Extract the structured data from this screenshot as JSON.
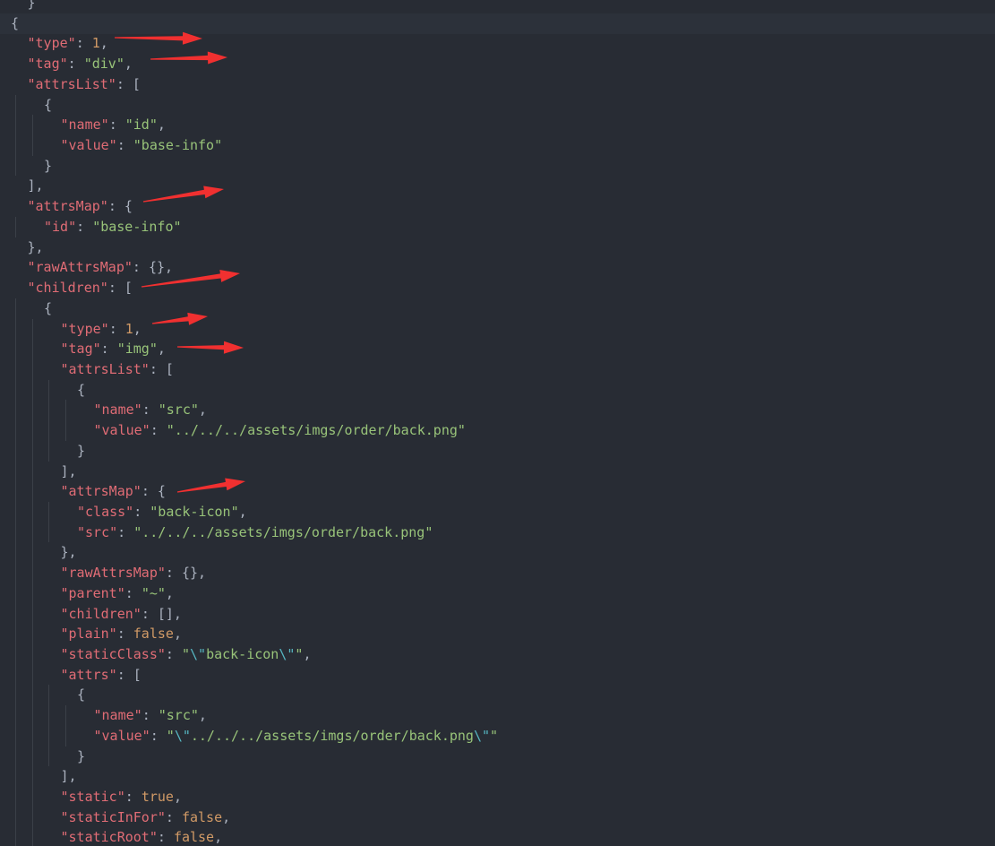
{
  "editor": {
    "colors": {
      "background": "#282c34",
      "key": "#e06c75",
      "string": "#98c379",
      "number": "#d19a66",
      "escape": "#56b6c2",
      "punctuation": "#abb2bf",
      "annotation_arrow": "#f03030"
    },
    "active_line": 1,
    "lines": [
      {
        "indent": 1,
        "tokens": [
          [
            "p",
            "}"
          ]
        ]
      },
      {
        "indent": 0,
        "tokens": [
          [
            "p",
            "{"
          ]
        ]
      },
      {
        "indent": 1,
        "tokens": [
          [
            "k",
            "\"type\""
          ],
          [
            "p",
            ": "
          ],
          [
            "n",
            "1"
          ],
          [
            "p",
            ","
          ]
        ]
      },
      {
        "indent": 1,
        "tokens": [
          [
            "k",
            "\"tag\""
          ],
          [
            "p",
            ": "
          ],
          [
            "s",
            "\"div\""
          ],
          [
            "p",
            ","
          ]
        ]
      },
      {
        "indent": 1,
        "tokens": [
          [
            "k",
            "\"attrsList\""
          ],
          [
            "p",
            ": ["
          ]
        ]
      },
      {
        "indent": 2,
        "tokens": [
          [
            "p",
            "{"
          ]
        ]
      },
      {
        "indent": 3,
        "tokens": [
          [
            "k",
            "\"name\""
          ],
          [
            "p",
            ": "
          ],
          [
            "s",
            "\"id\""
          ],
          [
            "p",
            ","
          ]
        ]
      },
      {
        "indent": 3,
        "tokens": [
          [
            "k",
            "\"value\""
          ],
          [
            "p",
            ": "
          ],
          [
            "s",
            "\"base-info\""
          ]
        ]
      },
      {
        "indent": 2,
        "tokens": [
          [
            "p",
            "}"
          ]
        ]
      },
      {
        "indent": 1,
        "tokens": [
          [
            "p",
            "],"
          ]
        ]
      },
      {
        "indent": 1,
        "tokens": [
          [
            "k",
            "\"attrsMap\""
          ],
          [
            "p",
            ": {"
          ]
        ]
      },
      {
        "indent": 2,
        "tokens": [
          [
            "k",
            "\"id\""
          ],
          [
            "p",
            ": "
          ],
          [
            "s",
            "\"base-info\""
          ]
        ]
      },
      {
        "indent": 1,
        "tokens": [
          [
            "p",
            "},"
          ]
        ]
      },
      {
        "indent": 1,
        "tokens": [
          [
            "k",
            "\"rawAttrsMap\""
          ],
          [
            "p",
            ": {},"
          ]
        ]
      },
      {
        "indent": 1,
        "tokens": [
          [
            "k",
            "\"children\""
          ],
          [
            "p",
            ": ["
          ]
        ]
      },
      {
        "indent": 2,
        "tokens": [
          [
            "p",
            "{"
          ]
        ]
      },
      {
        "indent": 3,
        "tokens": [
          [
            "k",
            "\"type\""
          ],
          [
            "p",
            ": "
          ],
          [
            "n",
            "1"
          ],
          [
            "p",
            ","
          ]
        ]
      },
      {
        "indent": 3,
        "tokens": [
          [
            "k",
            "\"tag\""
          ],
          [
            "p",
            ": "
          ],
          [
            "s",
            "\"img\""
          ],
          [
            "p",
            ","
          ]
        ]
      },
      {
        "indent": 3,
        "tokens": [
          [
            "k",
            "\"attrsList\""
          ],
          [
            "p",
            ": ["
          ]
        ]
      },
      {
        "indent": 4,
        "tokens": [
          [
            "p",
            "{"
          ]
        ]
      },
      {
        "indent": 5,
        "tokens": [
          [
            "k",
            "\"name\""
          ],
          [
            "p",
            ": "
          ],
          [
            "s",
            "\"src\""
          ],
          [
            "p",
            ","
          ]
        ]
      },
      {
        "indent": 5,
        "tokens": [
          [
            "k",
            "\"value\""
          ],
          [
            "p",
            ": "
          ],
          [
            "s",
            "\"../../../assets/imgs/order/back.png\""
          ]
        ]
      },
      {
        "indent": 4,
        "tokens": [
          [
            "p",
            "}"
          ]
        ]
      },
      {
        "indent": 3,
        "tokens": [
          [
            "p",
            "],"
          ]
        ]
      },
      {
        "indent": 3,
        "tokens": [
          [
            "k",
            "\"attrsMap\""
          ],
          [
            "p",
            ": {"
          ]
        ]
      },
      {
        "indent": 4,
        "tokens": [
          [
            "k",
            "\"class\""
          ],
          [
            "p",
            ": "
          ],
          [
            "s",
            "\"back-icon\""
          ],
          [
            "p",
            ","
          ]
        ]
      },
      {
        "indent": 4,
        "tokens": [
          [
            "k",
            "\"src\""
          ],
          [
            "p",
            ": "
          ],
          [
            "s",
            "\"../../../assets/imgs/order/back.png\""
          ]
        ]
      },
      {
        "indent": 3,
        "tokens": [
          [
            "p",
            "},"
          ]
        ]
      },
      {
        "indent": 3,
        "tokens": [
          [
            "k",
            "\"rawAttrsMap\""
          ],
          [
            "p",
            ": {},"
          ]
        ]
      },
      {
        "indent": 3,
        "tokens": [
          [
            "k",
            "\"parent\""
          ],
          [
            "p",
            ": "
          ],
          [
            "s",
            "\"~\""
          ],
          [
            "p",
            ","
          ]
        ]
      },
      {
        "indent": 3,
        "tokens": [
          [
            "k",
            "\"children\""
          ],
          [
            "p",
            ": [],"
          ]
        ]
      },
      {
        "indent": 3,
        "tokens": [
          [
            "k",
            "\"plain\""
          ],
          [
            "p",
            ": "
          ],
          [
            "n",
            "false"
          ],
          [
            "p",
            ","
          ]
        ]
      },
      {
        "indent": 3,
        "tokens": [
          [
            "k",
            "\"staticClass\""
          ],
          [
            "p",
            ": "
          ],
          [
            "s",
            "\""
          ],
          [
            "e",
            "\\\""
          ],
          [
            "s",
            "back-icon"
          ],
          [
            "e",
            "\\\""
          ],
          [
            "s",
            "\""
          ],
          [
            "p",
            ","
          ]
        ]
      },
      {
        "indent": 3,
        "tokens": [
          [
            "k",
            "\"attrs\""
          ],
          [
            "p",
            ": ["
          ]
        ]
      },
      {
        "indent": 4,
        "tokens": [
          [
            "p",
            "{"
          ]
        ]
      },
      {
        "indent": 5,
        "tokens": [
          [
            "k",
            "\"name\""
          ],
          [
            "p",
            ": "
          ],
          [
            "s",
            "\"src\""
          ],
          [
            "p",
            ","
          ]
        ]
      },
      {
        "indent": 5,
        "tokens": [
          [
            "k",
            "\"value\""
          ],
          [
            "p",
            ": "
          ],
          [
            "s",
            "\""
          ],
          [
            "e",
            "\\\""
          ],
          [
            "s",
            "../../../assets/imgs/order/back.png"
          ],
          [
            "e",
            "\\\""
          ],
          [
            "s",
            "\""
          ]
        ]
      },
      {
        "indent": 4,
        "tokens": [
          [
            "p",
            "}"
          ]
        ]
      },
      {
        "indent": 3,
        "tokens": [
          [
            "p",
            "],"
          ]
        ]
      },
      {
        "indent": 3,
        "tokens": [
          [
            "k",
            "\"static\""
          ],
          [
            "p",
            ": "
          ],
          [
            "n",
            "true"
          ],
          [
            "p",
            ","
          ]
        ]
      },
      {
        "indent": 3,
        "tokens": [
          [
            "k",
            "\"staticInFor\""
          ],
          [
            "p",
            ": "
          ],
          [
            "n",
            "false"
          ],
          [
            "p",
            ","
          ]
        ]
      },
      {
        "indent": 3,
        "tokens": [
          [
            "k",
            "\"staticRoot\""
          ],
          [
            "p",
            ": "
          ],
          [
            "n",
            "false"
          ],
          [
            "p",
            ","
          ]
        ]
      }
    ],
    "annotations": [
      {
        "kind": "arrow",
        "points_to_line": 2
      },
      {
        "kind": "arrow",
        "points_to_line": 3
      },
      {
        "kind": "arrow",
        "points_to_line": 10
      },
      {
        "kind": "arrow",
        "points_to_line": 14
      },
      {
        "kind": "arrow",
        "points_to_line": 16
      },
      {
        "kind": "arrow",
        "points_to_line": 17
      },
      {
        "kind": "arrow",
        "points_to_line": 24
      }
    ]
  }
}
